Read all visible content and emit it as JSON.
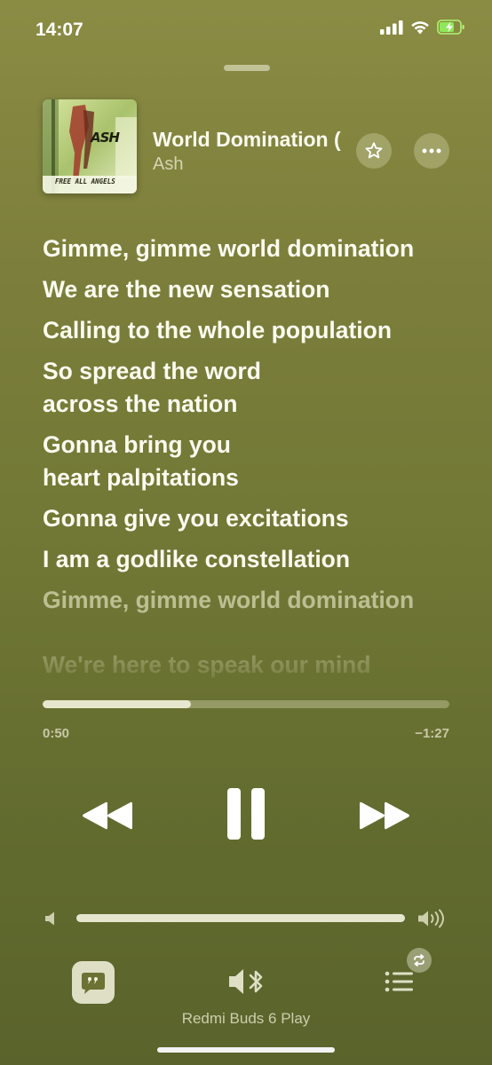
{
  "status_bar": {
    "time": "14:07"
  },
  "now_playing": {
    "album_art_text": "FREE ALL ANGELS",
    "album_art_logo": "ASH",
    "title": "World Domination (",
    "artist": "Ash"
  },
  "lyrics": {
    "lines": [
      "Gimme, gimme world domination",
      "We are the new sensation",
      "Calling to the whole population",
      "So spread the word\nacross the nation",
      "Gonna bring you\nheart palpitations",
      "Gonna give you excitations",
      "I am a godlike constellation",
      "Gimme, gimme world domination",
      "We're here to speak our mind"
    ]
  },
  "playback": {
    "elapsed": "0:50",
    "remaining": "−1:27",
    "progress_fraction": 0.365
  },
  "volume": {
    "level_fraction": 1.0
  },
  "output": {
    "device_name": "Redmi Buds 6 Play"
  },
  "icons": {
    "favorite": "star-icon",
    "more": "ellipsis-icon",
    "rewind": "backward-icon",
    "pause": "pause-icon",
    "forward": "forward-icon",
    "lyrics": "quote-bubble-icon",
    "airplay": "bluetooth-speaker-icon",
    "queue": "list-icon",
    "repeat": "repeat-icon"
  }
}
